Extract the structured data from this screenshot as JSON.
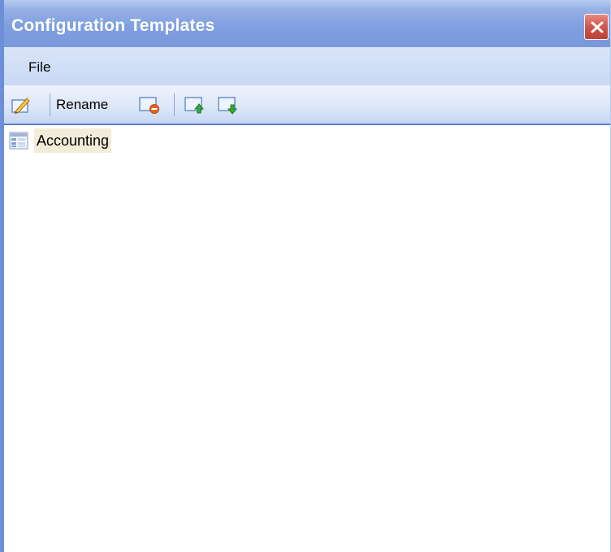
{
  "window": {
    "title": "Configuration Templates"
  },
  "menu": {
    "items": [
      {
        "label": "File"
      }
    ]
  },
  "toolbar": {
    "rename_label": "Rename",
    "icons": [
      "edit-pencil-icon",
      "delete-template-icon",
      "upload-template-icon",
      "download-template-icon"
    ]
  },
  "tree": {
    "items": [
      {
        "label": "Accounting",
        "icon": "template-document-icon"
      }
    ]
  },
  "colors": {
    "titlebar": "#7f9fe0",
    "menubar": "#c9d9f4",
    "toolbar_border": "#5a7fcb",
    "close_button": "#d1554a",
    "selection": "#f2ecd9"
  }
}
